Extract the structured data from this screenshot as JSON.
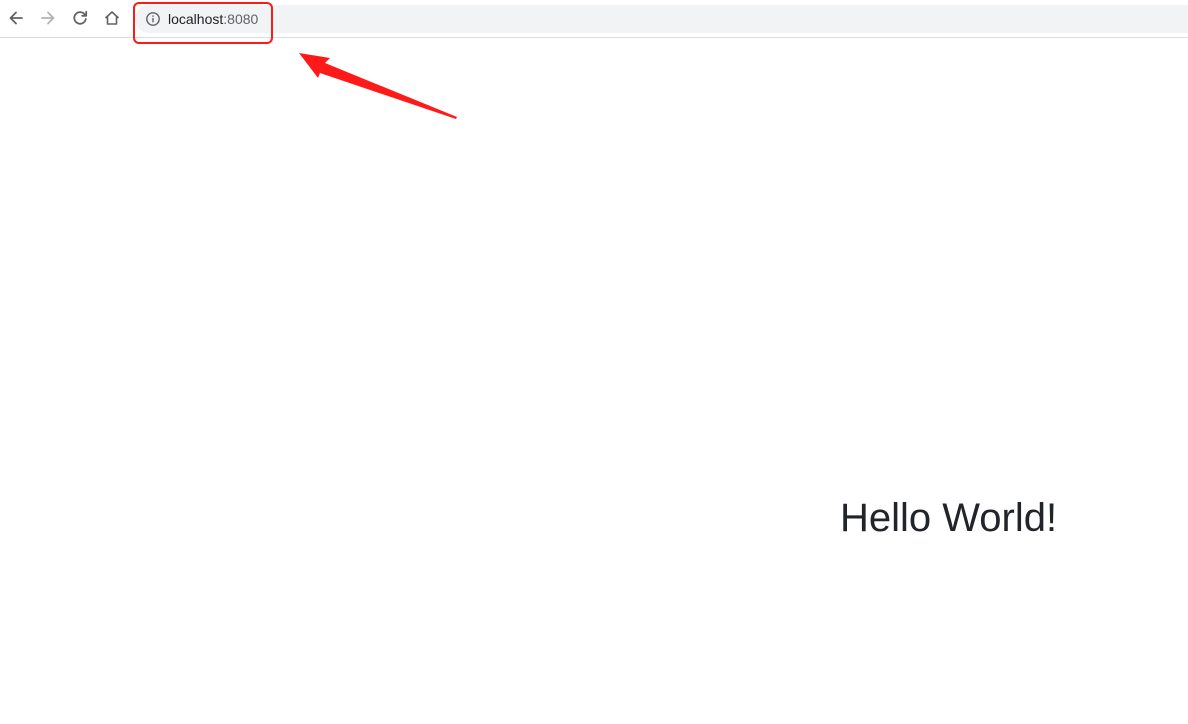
{
  "browser": {
    "address_bar": {
      "host": "localhost",
      "port": ":8080"
    },
    "icons": {
      "back": "arrow-left-icon",
      "forward": "arrow-right-icon",
      "reload": "reload-icon",
      "home": "home-icon",
      "info": "info-icon"
    }
  },
  "annotation": {
    "color": "#ff1a1a"
  },
  "page": {
    "heading": "Hello World!"
  }
}
